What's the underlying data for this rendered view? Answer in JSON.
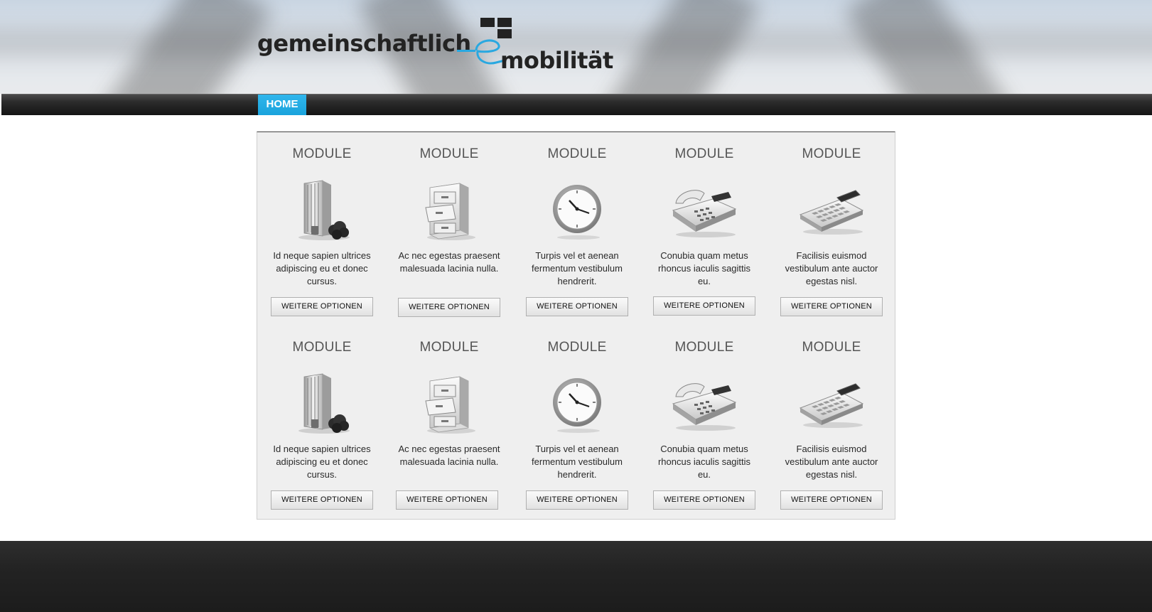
{
  "header": {
    "logo_text_1": "gemeinschaftlich",
    "logo_text_2": "mobilität",
    "logo_accent": "#29a8e0"
  },
  "nav": {
    "home_label": "HOME",
    "accent": "#1aa3dc"
  },
  "modules": [
    {
      "title": "MODULE",
      "icon": "office-building-icon",
      "desc": "Id neque sapien ultrices adipiscing eu et donec cursus.",
      "button": "WEITERE OPTIONEN"
    },
    {
      "title": "MODULE",
      "icon": "file-cabinet-icon",
      "desc": "Ac nec egestas praesent malesuada lacinia nulla.",
      "button": "WEITERE OPTIONEN"
    },
    {
      "title": "MODULE",
      "icon": "clock-icon",
      "desc": "Turpis vel et aenean fermentum vestibulum hendrerit.",
      "button": "WEITERE OPTIONEN"
    },
    {
      "title": "MODULE",
      "icon": "telephone-icon",
      "desc": "Conubia quam metus rhoncus iaculis sagittis eu.",
      "button": "WEITERE OPTIONEN"
    },
    {
      "title": "MODULE",
      "icon": "calculator-icon",
      "desc": "Facilisis euismod vestibulum ante auctor egestas nisl.",
      "button": "WEITERE OPTIONEN"
    },
    {
      "title": "MODULE",
      "icon": "office-building-icon",
      "desc": "Id neque sapien ultrices adipiscing eu et donec cursus.",
      "button": "WEITERE OPTIONEN"
    },
    {
      "title": "MODULE",
      "icon": "file-cabinet-icon",
      "desc": "Ac nec egestas praesent malesuada lacinia nulla.",
      "button": "WEITERE OPTIONEN"
    },
    {
      "title": "MODULE",
      "icon": "clock-icon",
      "desc": "Turpis vel et aenean fermentum vestibulum hendrerit.",
      "button": "WEITERE OPTIONEN"
    },
    {
      "title": "MODULE",
      "icon": "telephone-icon",
      "desc": "Conubia quam metus rhoncus iaculis sagittis eu.",
      "button": "WEITERE OPTIONEN"
    },
    {
      "title": "MODULE",
      "icon": "calculator-icon",
      "desc": "Facilisis euismod vestibulum ante auctor egestas nisl.",
      "button": "WEITERE OPTIONEN"
    }
  ]
}
